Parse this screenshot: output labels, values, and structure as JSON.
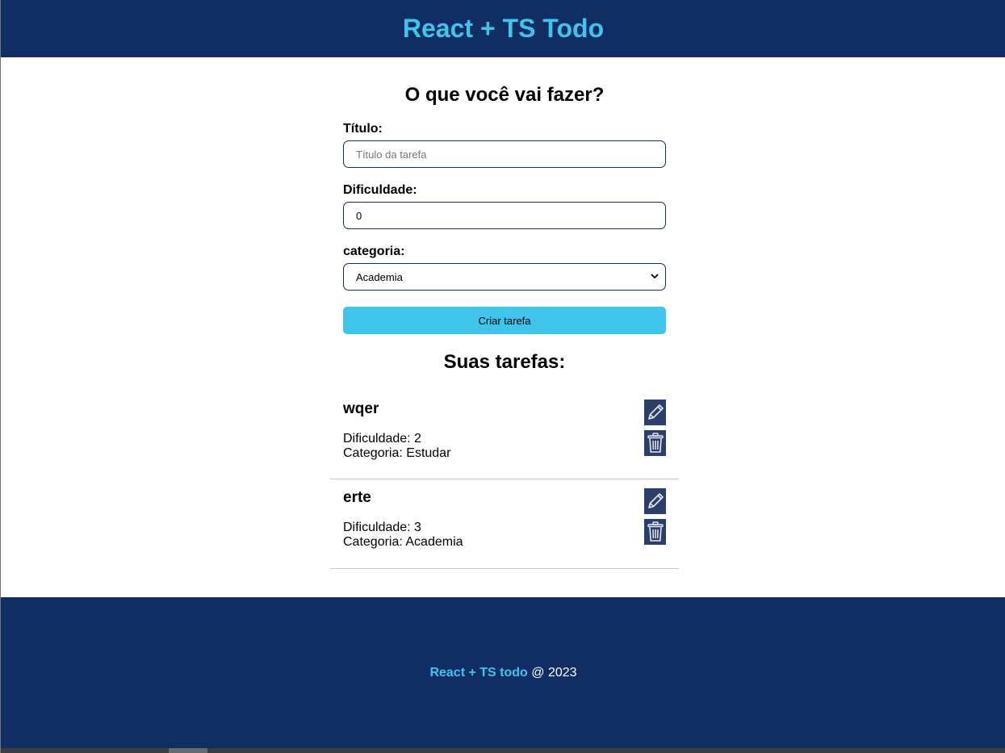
{
  "header": {
    "title": "React + TS Todo"
  },
  "form": {
    "heading": "O que você vai fazer?",
    "title_label": "Título:",
    "title_placeholder": "Título da tarefa",
    "title_value": "",
    "difficulty_label": "Dificuldade:",
    "difficulty_value": "0",
    "category_label": "categoria:",
    "category_selected": "Academia",
    "submit_label": "Criar tarefa"
  },
  "list": {
    "heading": "Suas tarefas:",
    "difficulty_prefix": "Dificuldade:",
    "category_prefix": "Categoria:",
    "tasks": [
      {
        "title": "wqer",
        "difficulty": "Dificuldade: 2",
        "category": "Categoria: Estudar"
      },
      {
        "title": "erte",
        "difficulty": "Dificuldade: 3",
        "category": "Categoria: Academia"
      }
    ]
  },
  "footer": {
    "brand": "React + TS todo",
    "suffix": "@ 2023"
  },
  "icons": {
    "edit": "pencil-icon",
    "delete": "trash-icon"
  },
  "colors": {
    "navy": "#112e64",
    "accent": "#3fc4ec",
    "icon_bg": "#2b3f6b"
  }
}
